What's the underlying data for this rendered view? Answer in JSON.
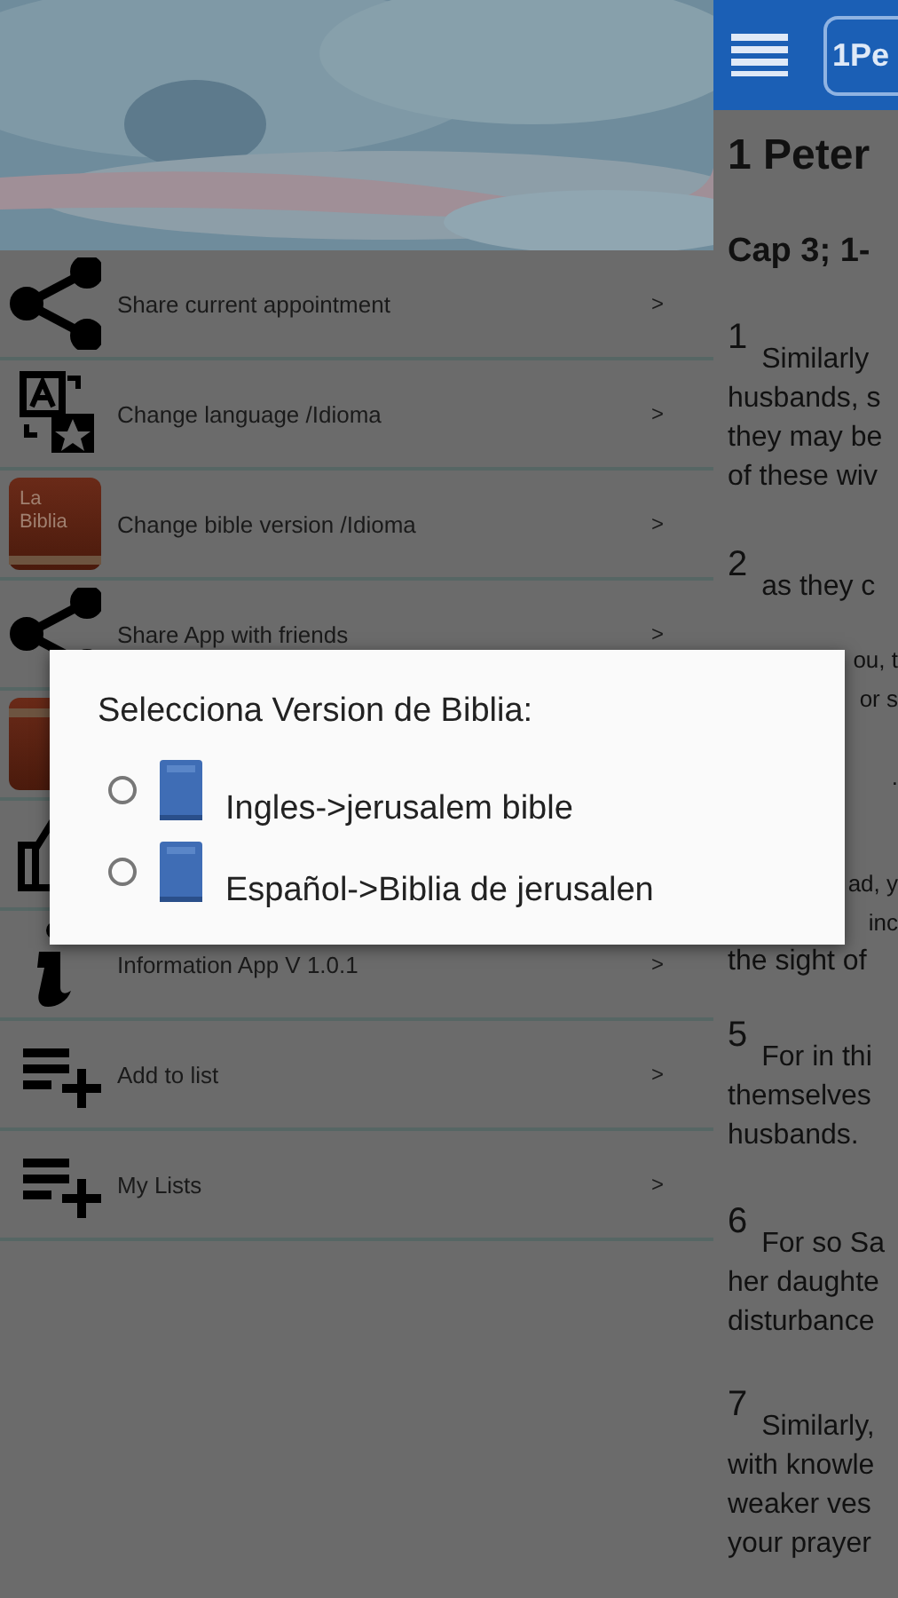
{
  "drawer": {
    "items": [
      {
        "kind": "share",
        "label": "Share current appointment",
        "arrow": ">"
      },
      {
        "kind": "translate",
        "label": "Change language /Idioma",
        "arrow": ">"
      },
      {
        "kind": "bible",
        "badge": "La Biblia",
        "label": "Change bible version /Idioma",
        "arrow": ">"
      },
      {
        "kind": "share",
        "label": "Share App with friends",
        "arrow": ">"
      },
      {
        "kind": "bible"
      },
      {
        "kind": "thumb"
      },
      {
        "kind": "info",
        "label": "Information App V 1.0.1",
        "arrow": ">"
      },
      {
        "kind": "playlist",
        "label": "Add to list",
        "arrow": ">"
      },
      {
        "kind": "playlist",
        "label": "My Lists",
        "arrow": ">"
      }
    ]
  },
  "reader": {
    "book_button": "1Pe",
    "title": "1 Peter",
    "chapter": "Cap 3; 1-",
    "verses": [
      {
        "number": "1",
        "lines": [
          {
            "kind": "first",
            "text": "Similarly"
          },
          {
            "kind": "full",
            "text": "husbands, s"
          },
          {
            "kind": "full",
            "text": "they may be"
          },
          {
            "kind": "full",
            "text": "of these wiv"
          }
        ]
      },
      {
        "number": "2",
        "lines": [
          {
            "kind": "first",
            "text": "as they c"
          }
        ]
      },
      {
        "lines": [
          {
            "kind": "cut",
            "text": "ou, t"
          },
          {
            "kind": "cut",
            "text": "or s"
          },
          {
            "kind": "cut",
            "text": "."
          }
        ]
      },
      {
        "lines": [
          {
            "kind": "cut",
            "text": "ad, y"
          },
          {
            "kind": "cut",
            "text": "inc"
          },
          {
            "kind": "full",
            "text": "the sight of"
          }
        ]
      },
      {
        "number": "5",
        "lines": [
          {
            "kind": "first",
            "text": "For in thi"
          },
          {
            "kind": "full",
            "text": "themselves"
          },
          {
            "kind": "full",
            "text": "husbands."
          }
        ]
      },
      {
        "number": "6",
        "lines": [
          {
            "kind": "first",
            "text": "For so Sa"
          },
          {
            "kind": "full",
            "text": "her daughte"
          },
          {
            "kind": "full",
            "text": "disturbance"
          }
        ]
      },
      {
        "number": "7",
        "lines": [
          {
            "kind": "first",
            "text": "Similarly,"
          },
          {
            "kind": "full",
            "text": "with knowle"
          },
          {
            "kind": "full",
            "text": "weaker ves"
          },
          {
            "kind": "full",
            "text": "your prayer"
          }
        ]
      }
    ]
  },
  "dialog": {
    "title": "Selecciona Version de Biblia:",
    "options": [
      {
        "label": "Ingles->jerusalem bible",
        "selected": false
      },
      {
        "label": "Español->Biblia de jerusalen",
        "selected": false
      }
    ]
  }
}
